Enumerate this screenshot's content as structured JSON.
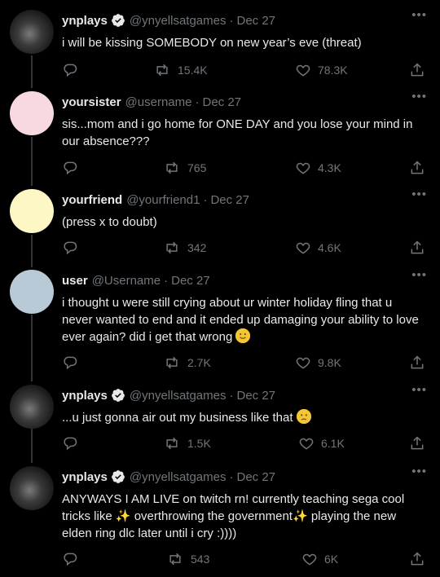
{
  "tweets": [
    {
      "name": "ynplays",
      "verified": true,
      "handle": "@ynyellsatgames",
      "date": "Dec 27",
      "text": "i will be kissing SOMEBODY on new year’s eve (threat)",
      "retweets": "15.4K",
      "likes": "78.3K",
      "avatar": "photo"
    },
    {
      "name": "yoursister",
      "verified": false,
      "handle": "@username",
      "date": "Dec 27",
      "text": "sis...mom and i go home for ONE DAY and you lose your mind in our absence???",
      "retweets": "765",
      "likes": "4.3K",
      "avatar": "pink"
    },
    {
      "name": "yourfriend",
      "verified": false,
      "handle": "@yourfriend1",
      "date": "Dec 27",
      "text": "(press x to doubt)",
      "retweets": "342",
      "likes": "4.6K",
      "avatar": "yellow"
    },
    {
      "name": "user",
      "verified": false,
      "handle": "@Username",
      "date": "Dec 27",
      "text": "i thought u were still crying about ur winter holiday fling that u never wanted to end and it ended up damaging your ability to love ever again? did i get that wrong",
      "retweets": "2.7K",
      "likes": "9.8K",
      "avatar": "blue",
      "emoji": "slightly-smiling-face"
    },
    {
      "name": "ynplays",
      "verified": true,
      "handle": "@ynyellsatgames",
      "date": "Dec 27",
      "text": "...u just gonna air out my business like that",
      "retweets": "1.5K",
      "likes": "6.1K",
      "avatar": "photo",
      "emoji": "worried-face"
    },
    {
      "name": "ynplays",
      "verified": true,
      "handle": "@ynyellsatgames",
      "date": "Dec 27",
      "text_parts": [
        "ANYWAYS I AM LIVE on twitch rn! currently teaching sega cool tricks like ",
        "✨",
        " overthrowing the government",
        "✨",
        " playing the new elden ring dlc later until i cry :))))"
      ],
      "retweets": "543",
      "likes": "6K",
      "avatar": "photo"
    }
  ],
  "icons": {
    "reply": "reply-icon",
    "retweet": "retweet-icon",
    "like": "heart-icon",
    "share": "share-icon",
    "more": "more-icon",
    "verified": "verified-badge-icon"
  },
  "colors": {
    "background": "#000000",
    "text": "#e7e9ea",
    "muted": "#71767b",
    "thread_line": "#333639"
  }
}
